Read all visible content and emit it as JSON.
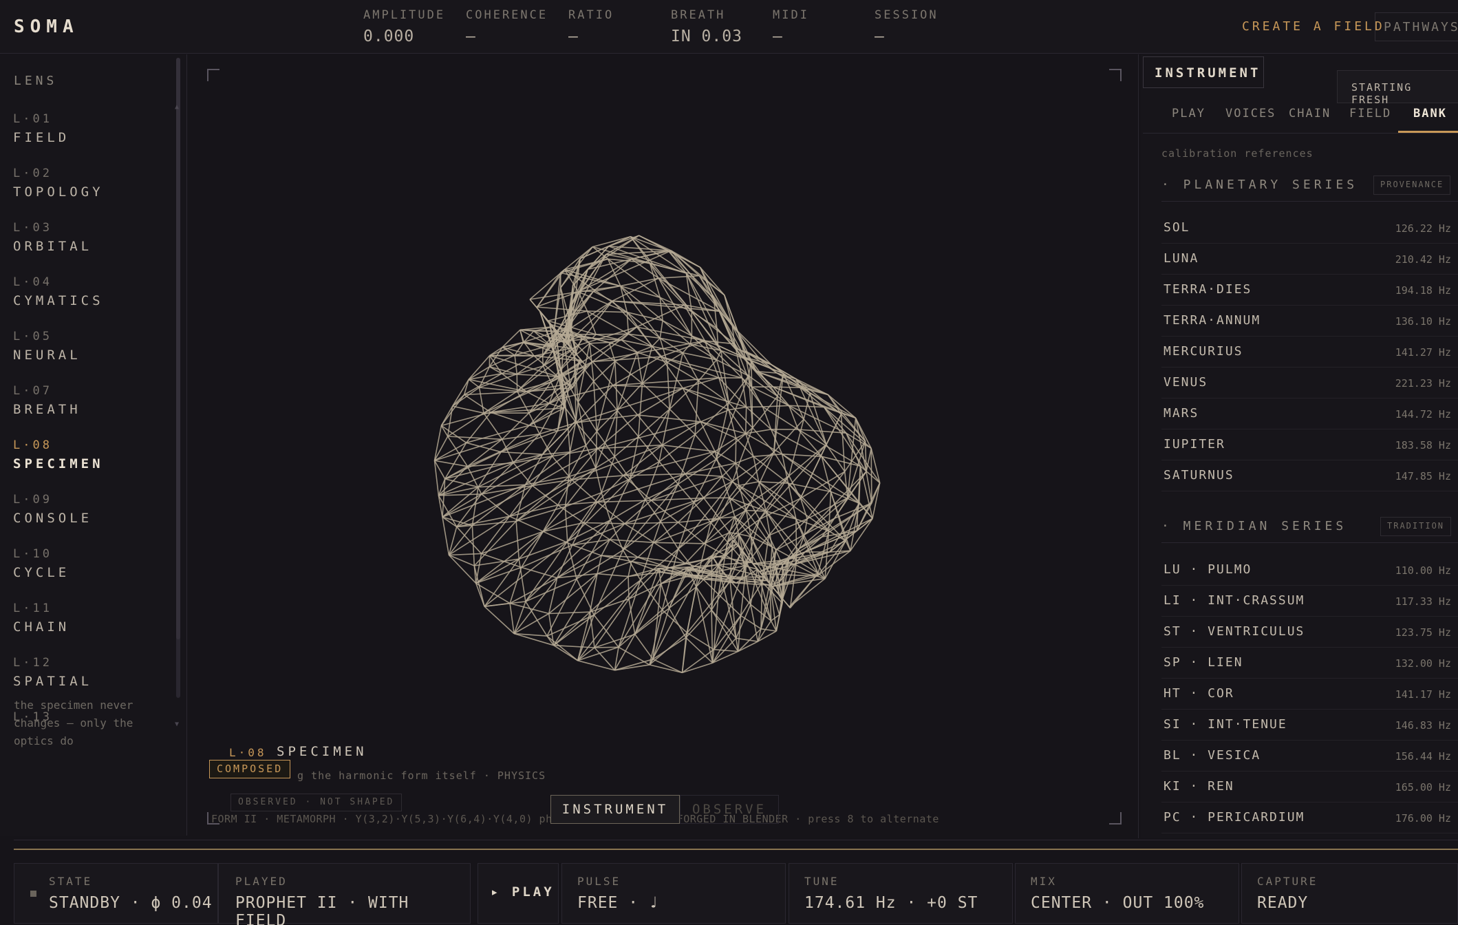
{
  "app": {
    "brand": "SOMA"
  },
  "topbar": {
    "stats": [
      {
        "label": "AMPLITUDE",
        "value": "0.000"
      },
      {
        "label": "COHERENCE",
        "value": "—"
      },
      {
        "label": "RATIO",
        "value": "—"
      },
      {
        "label": "BREATH",
        "value": "IN 0.03"
      },
      {
        "label": "MIDI",
        "value": "—"
      },
      {
        "label": "SESSION",
        "value": "—"
      }
    ],
    "create_field": "CREATE A FIELD",
    "pathways": "PATHWAYS"
  },
  "lens_panel": {
    "title": "LENS",
    "items": [
      {
        "num": "L·01",
        "name": "FIELD"
      },
      {
        "num": "L·02",
        "name": "TOPOLOGY"
      },
      {
        "num": "L·03",
        "name": "ORBITAL"
      },
      {
        "num": "L·04",
        "name": "CYMATICS"
      },
      {
        "num": "L·05",
        "name": "NEURAL"
      },
      {
        "num": "L·07",
        "name": "BREATH"
      },
      {
        "num": "L·08",
        "name": "SPECIMEN"
      },
      {
        "num": "L·09",
        "name": "CONSOLE"
      },
      {
        "num": "L·10",
        "name": "CYCLE"
      },
      {
        "num": "L·11",
        "name": "CHAIN"
      },
      {
        "num": "L·12",
        "name": "SPATIAL"
      },
      {
        "num": "L·13",
        "name": ""
      }
    ],
    "active_index": 6,
    "note": "the specimen never changes — only the optics do"
  },
  "viewport": {
    "lens_num": "L·08",
    "lens_name": "SPECIMEN",
    "badge": "COMPOSED",
    "description": "g the harmonic form itself · PHYSICS",
    "observed_tag": "OBSERVED · NOT SHAPED",
    "mode_instrument": "INSTRUMENT",
    "mode_observe": "OBSERVE",
    "form_line": "FORM II · METAMORPH · Y(3,2)·Y(5,3)·Y(6,4)·Y(4,0) phase-flow · 30/60 · FORGED IN BLENDER · press 8 to alternate",
    "mesh_color": "#b5a994",
    "accent": "#c89858"
  },
  "right_panel": {
    "instrument_tab": "INSTRUMENT",
    "starting_fresh": "STARTING FRESH",
    "tabs": [
      "PLAY",
      "VOICES",
      "CHAIN",
      "FIELD",
      "BANK"
    ],
    "active_tab": "BANK",
    "calibration": "calibration references",
    "planetary": {
      "title": "· PLANETARY SERIES",
      "tag": "PROVENANCE",
      "rows": [
        {
          "name": "SOL",
          "hz": "126.22 Hz"
        },
        {
          "name": "LUNA",
          "hz": "210.42 Hz"
        },
        {
          "name": "TERRA·DIES",
          "hz": "194.18 Hz"
        },
        {
          "name": "TERRA·ANNUM",
          "hz": "136.10 Hz"
        },
        {
          "name": "MERCURIUS",
          "hz": "141.27 Hz"
        },
        {
          "name": "VENUS",
          "hz": "221.23 Hz"
        },
        {
          "name": "MARS",
          "hz": "144.72 Hz"
        },
        {
          "name": "IUPITER",
          "hz": "183.58 Hz"
        },
        {
          "name": "SATURNUS",
          "hz": "147.85 Hz"
        }
      ]
    },
    "meridian": {
      "title": "· MERIDIAN SERIES",
      "tag": "TRADITION",
      "rows": [
        {
          "name": "LU · PULMO",
          "hz": "110.00 Hz"
        },
        {
          "name": "LI · INT·CRASSUM",
          "hz": "117.33 Hz"
        },
        {
          "name": "ST · VENTRICULUS",
          "hz": "123.75 Hz"
        },
        {
          "name": "SP · LIEN",
          "hz": "132.00 Hz"
        },
        {
          "name": "HT · COR",
          "hz": "141.17 Hz"
        },
        {
          "name": "SI · INT·TENUE",
          "hz": "146.83 Hz"
        },
        {
          "name": "BL · VESICA",
          "hz": "156.44 Hz"
        },
        {
          "name": "KI · REN",
          "hz": "165.00 Hz"
        },
        {
          "name": "PC · PERICARDIUM",
          "hz": "176.00 Hz"
        }
      ]
    }
  },
  "statusbar": {
    "state": {
      "label": "STATE",
      "value": "STANDBY · ϕ 0.04"
    },
    "played": {
      "label": "PLAYED",
      "value": "PROPHET II · WITH FIELD"
    },
    "play_button": "▸ PLAY",
    "pulse": {
      "label": "PULSE",
      "value": "FREE · ♩"
    },
    "tune": {
      "label": "TUNE",
      "value": "174.61 Hz · +0 ST"
    },
    "mix": {
      "label": "MIX",
      "value": "CENTER · OUT 100%"
    },
    "capture": {
      "label": "CAPTURE",
      "value": "READY"
    }
  }
}
